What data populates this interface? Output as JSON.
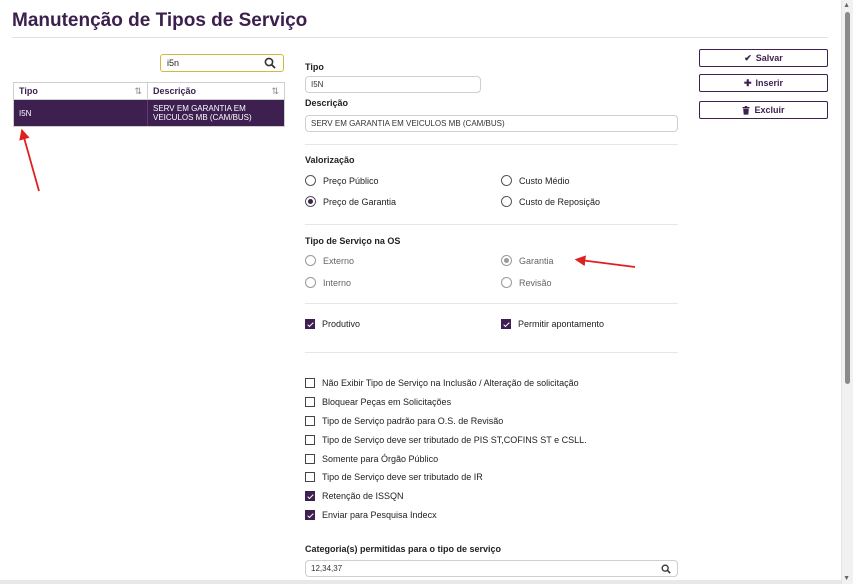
{
  "page": {
    "title": "Manutenção de Tipos de Serviço"
  },
  "search": {
    "value": "i5n"
  },
  "table": {
    "headers": {
      "tipo": "Tipo",
      "descricao": "Descrição"
    },
    "rows": [
      {
        "tipo": "I5N",
        "descricao": "SERV EM GARANTIA EM VEICULOS MB (CAM/BUS)"
      }
    ]
  },
  "form": {
    "tipo_label": "Tipo",
    "tipo_value": "I5N",
    "descricao_label": "Descrição",
    "descricao_value": "SERV EM GARANTIA EM VEICULOS MB  (CAM/BUS)",
    "valorizacao": {
      "label": "Valorização",
      "options": [
        "Preço Público",
        "Custo Médio",
        "Preço de Garantia",
        "Custo de Reposição"
      ],
      "selected": "Preço de Garantia"
    },
    "tipo_servico_os": {
      "label": "Tipo de Serviço na OS",
      "options": [
        "Externo",
        "Garantia",
        "Interno",
        "Revisão"
      ],
      "selected": "Garantia"
    },
    "produtivo": {
      "label": "Produtivo",
      "checked": true
    },
    "permitir": {
      "label": "Permitir apontamento",
      "checked": true
    },
    "checks": [
      {
        "label": "Não Exibir Tipo de Serviço na Inclusão / Alteração de solicitação",
        "checked": false
      },
      {
        "label": "Bloquear Peças em Solicitações",
        "checked": false
      },
      {
        "label": "Tipo de Serviço padrão para O.S. de Revisão",
        "checked": false
      },
      {
        "label": "Tipo de Serviço deve ser tributado de PIS ST,COFINS ST e CSLL.",
        "checked": false
      },
      {
        "label": "Somente para Órgão Público",
        "checked": false
      },
      {
        "label": "Tipo de Serviço deve ser tributado de IR",
        "checked": false
      },
      {
        "label": "Retenção de ISSQN",
        "checked": true
      },
      {
        "label": "Enviar para Pesquisa Indecx",
        "checked": true
      }
    ],
    "categoria_label": "Categoria(s) permitidas para o tipo de serviço",
    "categoria_value": "12,34,37"
  },
  "buttons": {
    "salvar": "Salvar",
    "inserir": "Inserir",
    "excluir": "Excluir"
  },
  "colors": {
    "primary": "#3d1f50",
    "arrow": "#e02020"
  }
}
